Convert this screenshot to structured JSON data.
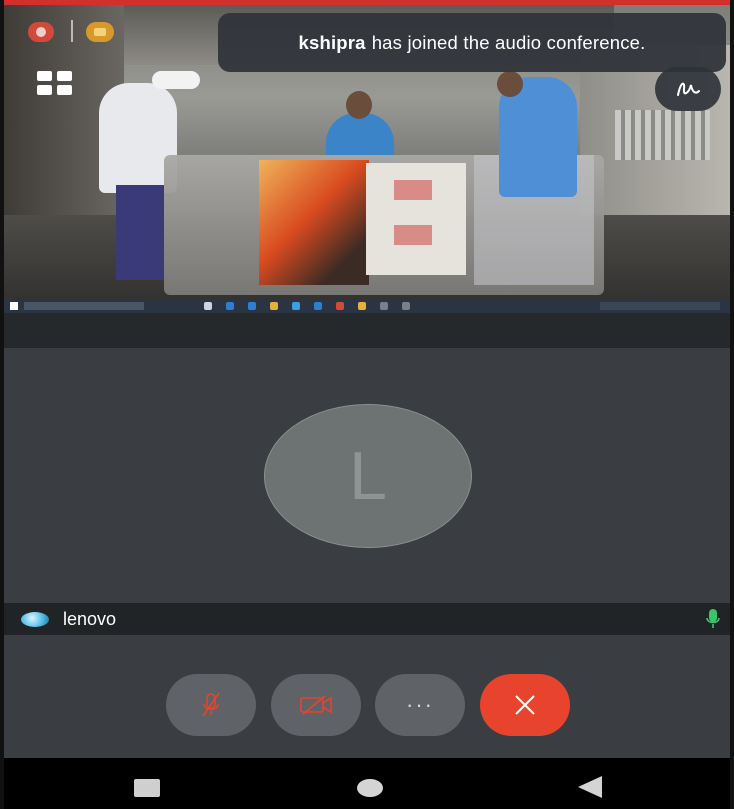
{
  "notification": {
    "user": "kshipra",
    "message": "has joined the audio conference."
  },
  "participant": {
    "initial": "L",
    "name": "lenovo"
  },
  "controls": {
    "more_label": "···"
  },
  "colors": {
    "accent_red": "#e8432d",
    "mic_green": "#3cc36c",
    "top_bar_red": "#d3302b"
  },
  "icons": {
    "recording": "record-icon",
    "host": "crown-icon",
    "layout": "grid-icon",
    "annotate": "pen-icon",
    "mic_muted": "mic-off-icon",
    "video_off": "video-off-icon",
    "end": "close-icon"
  }
}
